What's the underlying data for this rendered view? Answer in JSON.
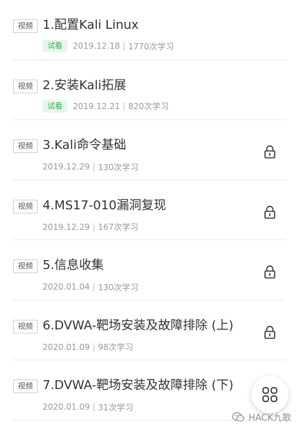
{
  "colors": {
    "accent_green": "#2bb34a",
    "trial_bg": "#e6f7e9",
    "meta_gray": "#999999"
  },
  "courses": [
    {
      "tag": "视频",
      "title": "1.配置Kali Linux",
      "trial_label": "试看",
      "date": "2019.12.18",
      "learners": "1770次学习",
      "locked": false
    },
    {
      "tag": "视频",
      "title": "2.安装Kali拓展",
      "trial_label": "试看",
      "date": "2019.12.21",
      "learners": "820次学习",
      "locked": false
    },
    {
      "tag": "视频",
      "title": "3.Kali命令基础",
      "date": "2019.12.29",
      "learners": "130次学习",
      "locked": true,
      "icon": "lock-icon"
    },
    {
      "tag": "视频",
      "title": "4.MS17-010漏洞复现",
      "date": "2019.12.29",
      "learners": "167次学习",
      "locked": true,
      "icon": "lock-icon"
    },
    {
      "tag": "视频",
      "title": "5.信息收集",
      "date": "2020.01.04",
      "learners": "130次学习",
      "locked": true,
      "icon": "lock-icon"
    },
    {
      "tag": "视频",
      "title": "6.DVWA-靶场安装及故障排除 (上)",
      "date": "2020.01.09",
      "learners": "98次学习",
      "locked": true,
      "icon": "lock-icon"
    },
    {
      "tag": "视频",
      "title": "7.DVWA-靶场安装及故障排除 (下)",
      "date": "2020.01.09",
      "learners": "31次学习",
      "locked": false
    }
  ],
  "meta_separator": "|",
  "fab": {
    "icon": "menu-grid-icon"
  },
  "watermark": {
    "text": "HACK九歌",
    "icon": "wechat-icon"
  }
}
